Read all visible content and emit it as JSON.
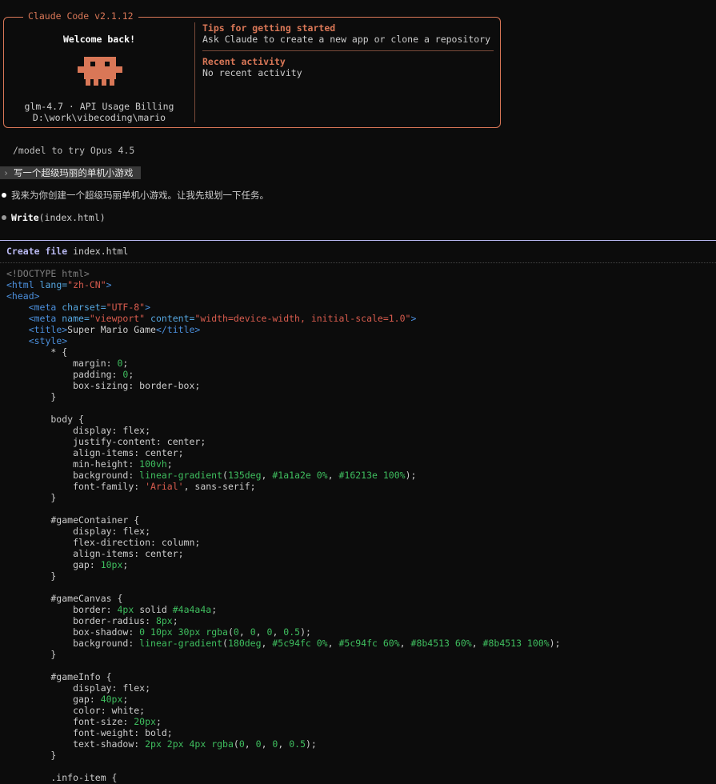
{
  "panel": {
    "title": "Claude Code v2.1.12",
    "welcome": "Welcome back!",
    "model_line": "glm-4.7 · API Usage Billing",
    "cwd": "D:\\work\\vibecoding\\mario",
    "tips_heading": "Tips for getting started",
    "tips_text": "Ask Claude to create a new app or clone a repository",
    "recent_heading": "Recent activity",
    "recent_text": "No recent activity",
    "mascot_icon": "claude-mascot-icon",
    "accent_color": "#d97757"
  },
  "hint": "/model to try Opus 4.5",
  "user_message": "写一个超级玛丽的单机小游戏",
  "assistant_message": "我来为你创建一个超级玛丽单机小游戏。让我先规划一下任务。",
  "tool": {
    "name": "Write",
    "args": "(index.html)"
  },
  "create": {
    "keyword": "Create file",
    "filename": "index.html"
  },
  "code_lines": [
    [
      [
        "<!DOCTYPE html>",
        "gray"
      ]
    ],
    [
      [
        "<html ",
        "tag"
      ],
      [
        "lang=",
        "attr"
      ],
      [
        "\"zh-CN\"",
        "str"
      ],
      [
        ">",
        "tag"
      ]
    ],
    [
      [
        "<head>",
        "tag"
      ]
    ],
    [
      [
        "    ",
        "txt"
      ],
      [
        "<meta ",
        "tag"
      ],
      [
        "charset=",
        "attr"
      ],
      [
        "\"UTF-8\"",
        "str"
      ],
      [
        ">",
        "tag"
      ]
    ],
    [
      [
        "    ",
        "txt"
      ],
      [
        "<meta ",
        "tag"
      ],
      [
        "name=",
        "attr"
      ],
      [
        "\"viewport\" ",
        "str"
      ],
      [
        "content=",
        "attr"
      ],
      [
        "\"width=device-width, initial-scale=1.0\"",
        "str"
      ],
      [
        ">",
        "tag"
      ]
    ],
    [
      [
        "    ",
        "txt"
      ],
      [
        "<title>",
        "tag"
      ],
      [
        "Super Mario Game",
        "txt"
      ],
      [
        "</title>",
        "tag"
      ]
    ],
    [
      [
        "    ",
        "txt"
      ],
      [
        "<style>",
        "tag"
      ]
    ],
    [
      [
        "        * {",
        "txt"
      ]
    ],
    [
      [
        "            margin: ",
        "txt"
      ],
      [
        "0",
        "num"
      ],
      [
        ";",
        "txt"
      ]
    ],
    [
      [
        "            padding: ",
        "txt"
      ],
      [
        "0",
        "num"
      ],
      [
        ";",
        "txt"
      ]
    ],
    [
      [
        "            box-sizing: border-box;",
        "txt"
      ]
    ],
    [
      [
        "        }",
        "txt"
      ]
    ],
    [
      [
        "",
        "txt"
      ]
    ],
    [
      [
        "        body {",
        "txt"
      ]
    ],
    [
      [
        "            display: flex;",
        "txt"
      ]
    ],
    [
      [
        "            justify-content: center;",
        "txt"
      ]
    ],
    [
      [
        "            align-items: center;",
        "txt"
      ]
    ],
    [
      [
        "            min-height: ",
        "txt"
      ],
      [
        "100vh",
        "num"
      ],
      [
        ";",
        "txt"
      ]
    ],
    [
      [
        "            background: ",
        "txt"
      ],
      [
        "linear-gradient",
        "fn"
      ],
      [
        "(",
        "txt"
      ],
      [
        "135deg",
        "num"
      ],
      [
        ", ",
        "txt"
      ],
      [
        "#1a1a2e 0%",
        "num"
      ],
      [
        ", ",
        "txt"
      ],
      [
        "#16213e 100%",
        "num"
      ],
      [
        ");",
        "txt"
      ]
    ],
    [
      [
        "            font-family: ",
        "txt"
      ],
      [
        "'Arial'",
        "str"
      ],
      [
        ", sans-serif;",
        "txt"
      ]
    ],
    [
      [
        "        }",
        "txt"
      ]
    ],
    [
      [
        "",
        "txt"
      ]
    ],
    [
      [
        "        #gameContainer {",
        "txt"
      ]
    ],
    [
      [
        "            display: flex;",
        "txt"
      ]
    ],
    [
      [
        "            flex-direction: column;",
        "txt"
      ]
    ],
    [
      [
        "            align-items: center;",
        "txt"
      ]
    ],
    [
      [
        "            gap: ",
        "txt"
      ],
      [
        "10px",
        "num"
      ],
      [
        ";",
        "txt"
      ]
    ],
    [
      [
        "        }",
        "txt"
      ]
    ],
    [
      [
        "",
        "txt"
      ]
    ],
    [
      [
        "        #gameCanvas {",
        "txt"
      ]
    ],
    [
      [
        "            border: ",
        "txt"
      ],
      [
        "4px",
        "num"
      ],
      [
        " solid ",
        "txt"
      ],
      [
        "#4a4a4a",
        "num"
      ],
      [
        ";",
        "txt"
      ]
    ],
    [
      [
        "            border-radius: ",
        "txt"
      ],
      [
        "8px",
        "num"
      ],
      [
        ";",
        "txt"
      ]
    ],
    [
      [
        "            box-shadow: ",
        "txt"
      ],
      [
        "0 10px 30px ",
        "num"
      ],
      [
        "rgba",
        "fn"
      ],
      [
        "(",
        "txt"
      ],
      [
        "0",
        "num"
      ],
      [
        ", ",
        "txt"
      ],
      [
        "0",
        "num"
      ],
      [
        ", ",
        "txt"
      ],
      [
        "0",
        "num"
      ],
      [
        ", ",
        "txt"
      ],
      [
        "0.5",
        "num"
      ],
      [
        ");",
        "txt"
      ]
    ],
    [
      [
        "            background: ",
        "txt"
      ],
      [
        "linear-gradient",
        "fn"
      ],
      [
        "(",
        "txt"
      ],
      [
        "180deg",
        "num"
      ],
      [
        ", ",
        "txt"
      ],
      [
        "#5c94fc 0%",
        "num"
      ],
      [
        ", ",
        "txt"
      ],
      [
        "#5c94fc 60%",
        "num"
      ],
      [
        ", ",
        "txt"
      ],
      [
        "#8b4513 60%",
        "num"
      ],
      [
        ", ",
        "txt"
      ],
      [
        "#8b4513 100%",
        "num"
      ],
      [
        ");",
        "txt"
      ]
    ],
    [
      [
        "        }",
        "txt"
      ]
    ],
    [
      [
        "",
        "txt"
      ]
    ],
    [
      [
        "        #gameInfo {",
        "txt"
      ]
    ],
    [
      [
        "            display: flex;",
        "txt"
      ]
    ],
    [
      [
        "            gap: ",
        "txt"
      ],
      [
        "40px",
        "num"
      ],
      [
        ";",
        "txt"
      ]
    ],
    [
      [
        "            color: white;",
        "txt"
      ]
    ],
    [
      [
        "            font-size: ",
        "txt"
      ],
      [
        "20px",
        "num"
      ],
      [
        ";",
        "txt"
      ]
    ],
    [
      [
        "            font-weight: bold;",
        "txt"
      ]
    ],
    [
      [
        "            text-shadow: ",
        "txt"
      ],
      [
        "2px 2px 4px ",
        "num"
      ],
      [
        "rgba",
        "fn"
      ],
      [
        "(",
        "txt"
      ],
      [
        "0",
        "num"
      ],
      [
        ", ",
        "txt"
      ],
      [
        "0",
        "num"
      ],
      [
        ", ",
        "txt"
      ],
      [
        "0",
        "num"
      ],
      [
        ", ",
        "txt"
      ],
      [
        "0.5",
        "num"
      ],
      [
        ");",
        "txt"
      ]
    ],
    [
      [
        "        }",
        "txt"
      ]
    ],
    [
      [
        "",
        "txt"
      ]
    ],
    [
      [
        "        .info-item {",
        "txt"
      ]
    ]
  ]
}
